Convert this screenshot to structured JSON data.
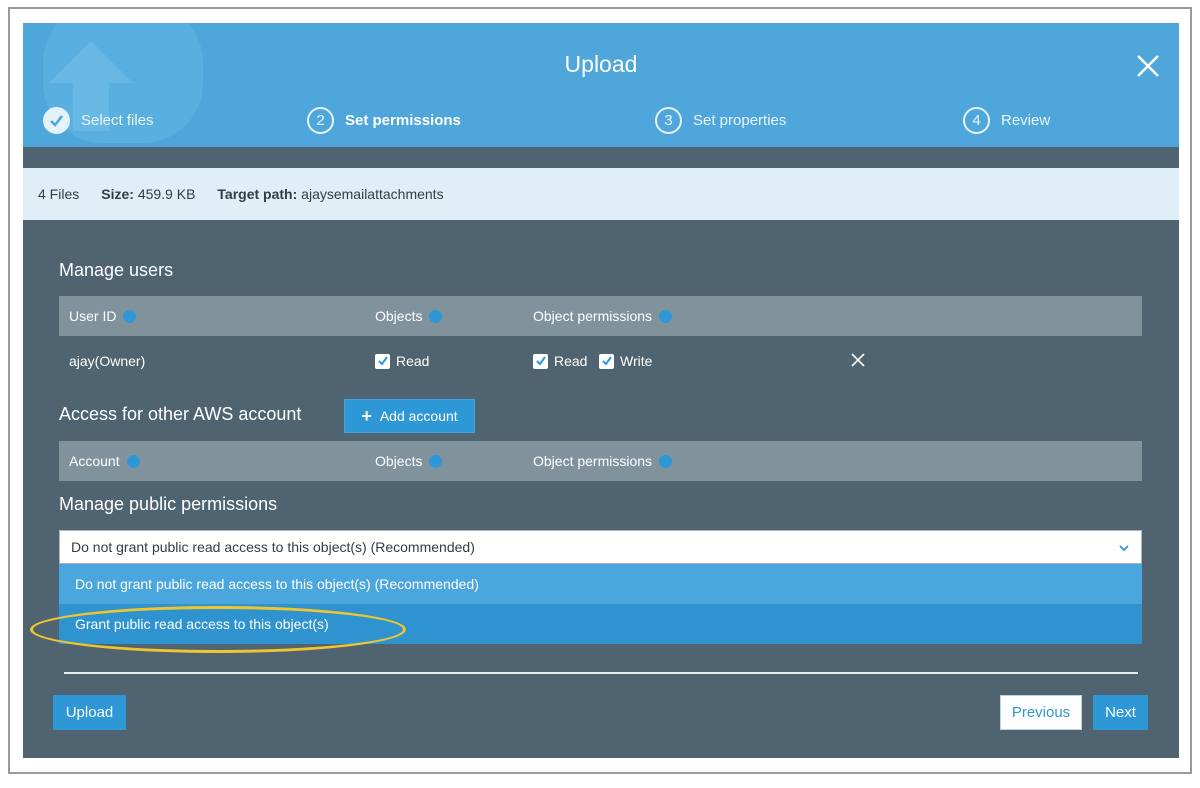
{
  "dialog": {
    "title": "Upload"
  },
  "steps": [
    {
      "number": "1",
      "label": "Select files",
      "state": "done"
    },
    {
      "number": "2",
      "label": "Set permissions",
      "state": "active"
    },
    {
      "number": "3",
      "label": "Set properties",
      "state": "pending"
    },
    {
      "number": "4",
      "label": "Review",
      "state": "pending"
    }
  ],
  "summary": {
    "files": "4 Files",
    "size_label": "Size:",
    "size_value": "459.9 KB",
    "target_label": "Target path:",
    "target_value": "ajaysemailattachments"
  },
  "manage_users": {
    "title": "Manage users",
    "columns": [
      "User ID",
      "Objects",
      "Object permissions"
    ],
    "rows": [
      {
        "user_id": "ajay(Owner)",
        "objects": [
          {
            "label": "Read",
            "checked": true
          }
        ],
        "object_permissions": [
          {
            "label": "Read",
            "checked": true
          },
          {
            "label": "Write",
            "checked": true
          }
        ]
      }
    ]
  },
  "other_accounts": {
    "title": "Access for other AWS account",
    "add_button": "Add account",
    "columns": [
      "Account",
      "Objects",
      "Object permissions"
    ]
  },
  "public_permissions": {
    "title": "Manage public permissions",
    "selected": "Do not grant public read access to this object(s) (Recommended)",
    "options": [
      "Do not grant public read access to this object(s) (Recommended)",
      "Grant public read access to this object(s)"
    ],
    "hovered_option_index": 1,
    "annotation": "highlighted-option"
  },
  "footer": {
    "upload": "Upload",
    "previous": "Previous",
    "next": "Next"
  },
  "colors": {
    "header": "#4ea6db",
    "body": "#4f6470",
    "accent": "#2e97d6",
    "table_header": "#80939d",
    "highlight_ring": "#f0c530"
  }
}
